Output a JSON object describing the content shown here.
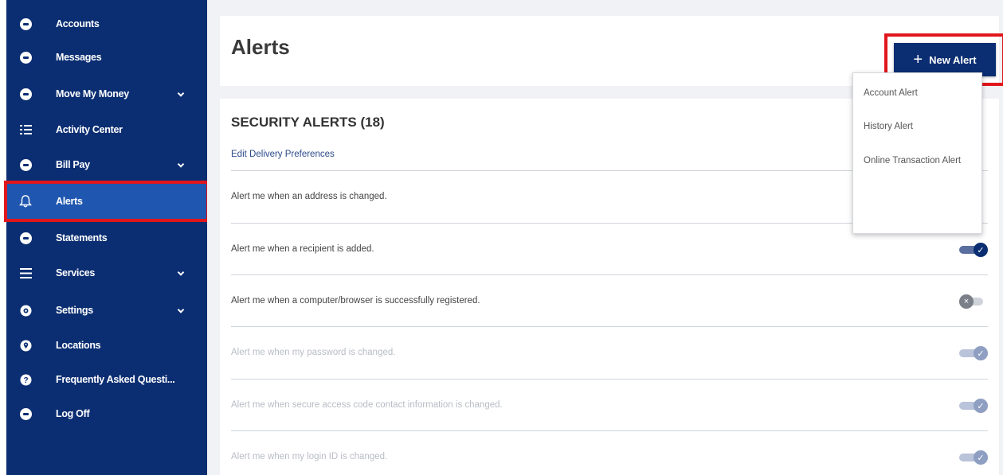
{
  "sidebar": {
    "items": [
      {
        "label": "Accounts",
        "icon": "accounts-icon",
        "has_chevron": false
      },
      {
        "label": "Messages",
        "icon": "messages-icon",
        "has_chevron": false
      },
      {
        "label": "Move My Money",
        "icon": "transfer-icon",
        "has_chevron": true
      },
      {
        "label": "Activity Center",
        "icon": "list-icon",
        "has_chevron": false
      },
      {
        "label": "Bill Pay",
        "icon": "bill-icon",
        "has_chevron": true
      },
      {
        "label": "Alerts",
        "icon": "bell-icon",
        "has_chevron": false,
        "active": true
      },
      {
        "label": "Statements",
        "icon": "statements-icon",
        "has_chevron": false
      },
      {
        "label": "Services",
        "icon": "menu-icon",
        "has_chevron": true
      },
      {
        "label": "Settings",
        "icon": "gear-icon",
        "has_chevron": true
      },
      {
        "label": "Locations",
        "icon": "location-pin-icon",
        "has_chevron": false
      },
      {
        "label": "Frequently Asked Questi...",
        "icon": "question-icon",
        "has_chevron": false
      },
      {
        "label": "Log Off",
        "icon": "logoff-icon",
        "has_chevron": false
      }
    ]
  },
  "header": {
    "title": "Alerts",
    "new_alert_label": "New Alert"
  },
  "dropdown": {
    "options": [
      "Account Alert",
      "History Alert",
      "Online Transaction Alert"
    ]
  },
  "security": {
    "title": "SECURITY ALERTS (18)",
    "edit_link": "Edit Delivery Preferences",
    "alerts": [
      {
        "text": "Alert me when an address is changed.",
        "state": "hidden"
      },
      {
        "text": "Alert me when a recipient is added.",
        "state": "on"
      },
      {
        "text": "Alert me when a computer/browser is successfully registered.",
        "state": "off"
      },
      {
        "text": "Alert me when my password is changed.",
        "state": "dim"
      },
      {
        "text": "Alert me when secure access code contact information is changed.",
        "state": "dim"
      },
      {
        "text": "Alert me when my login ID is changed.",
        "state": "dim"
      }
    ]
  },
  "colors": {
    "sidebar_bg": "#0b2e72",
    "active_item_bg": "#1f56b0",
    "highlight_red": "#e0161b"
  }
}
